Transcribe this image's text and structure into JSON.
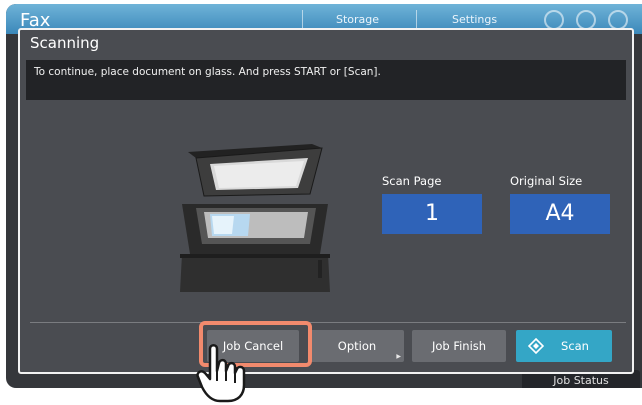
{
  "background": {
    "app_title": "Fax",
    "tabs": [
      "Storage",
      "Settings"
    ],
    "job_status_label": "Job Status"
  },
  "dialog": {
    "title": "Scanning",
    "message": "To continue, place document on glass. And press START or [Scan].",
    "scan_page": {
      "label": "Scan Page",
      "value": "1"
    },
    "original_size": {
      "label": "Original Size",
      "value": "A4"
    },
    "buttons": {
      "job_cancel": "Job Cancel",
      "option": "Option",
      "job_finish": "Job Finish",
      "scan": "Scan"
    }
  },
  "colors": {
    "value_box": "#2f63b8",
    "scan_button": "#34a6c6",
    "highlight": "#f28a6d",
    "top_bar": "#3b88ba"
  },
  "icons": [
    "scanner-illustration",
    "scan-diamond-icon",
    "hand-pointer-icon"
  ]
}
